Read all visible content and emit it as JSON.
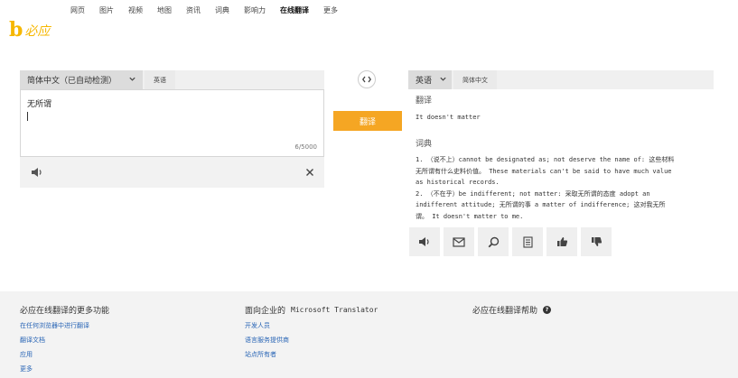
{
  "nav": {
    "items": [
      {
        "label": "网页",
        "active": false
      },
      {
        "label": "图片",
        "active": false
      },
      {
        "label": "视频",
        "active": false
      },
      {
        "label": "地图",
        "active": false
      },
      {
        "label": "资讯",
        "active": false
      },
      {
        "label": "词典",
        "active": false
      },
      {
        "label": "影响力",
        "active": false
      },
      {
        "label": "在线翻译",
        "active": true
      },
      {
        "label": "更多",
        "active": false
      }
    ]
  },
  "logo": {
    "mark": "b",
    "text": "必应",
    "color": "#f6b700"
  },
  "source": {
    "selected_language": "简体中文（已自动检测）",
    "tab": "英语",
    "text": "无所谓",
    "counter": "6/5000"
  },
  "translate_button": "翻译",
  "target": {
    "selected_language": "英语",
    "tab": "简体中文",
    "translation_heading": "翻译",
    "translation": "It doesn't matter",
    "dictionary_heading": "词典",
    "dictionary_lines": [
      "1. （说不上）cannot be designated as; not deserve the name of: 这些材料",
      "无所谓有什么史料价值。 These materials can't be said to have much value",
      "as historical records.",
      "2. （不在乎）be indifferent; not matter: 采取无所谓的态度 adopt an",
      "indifferent attitude; 无所谓的事 a matter of indifference; 这对我无所",
      "谓。 It doesn't matter to me."
    ]
  },
  "footer": {
    "col1": {
      "title": "必应在线翻译的更多功能",
      "links": [
        "在任何浏览器中进行翻译",
        "翻译文档",
        "应用",
        "更多"
      ]
    },
    "col2": {
      "title_prefix": "面向企业的",
      "title_mono": "Microsoft Translator",
      "links": [
        "开发人员",
        "语言服务提供商",
        "站点所有者"
      ]
    },
    "col3": {
      "title": "必应在线翻译帮助",
      "help_glyph": "?"
    }
  },
  "accent_color": "#f5a623",
  "link_color": "#2a66b6"
}
